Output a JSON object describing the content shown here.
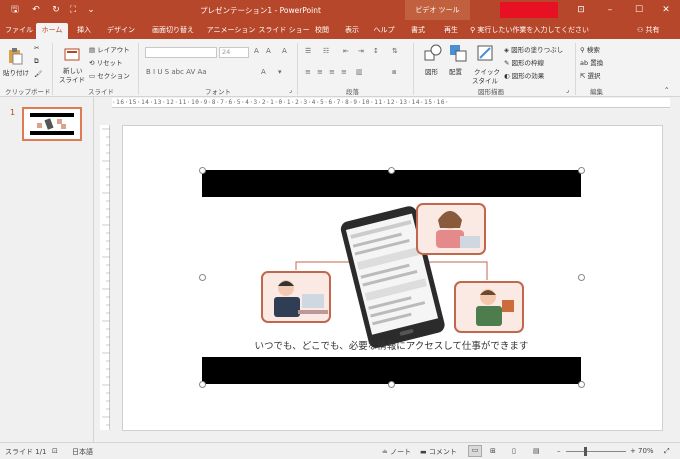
{
  "titlebar": {
    "title": "プレゼンテーション1 - PowerPoint",
    "context_tab": "ビデオ ツール",
    "accent": "#b7472a"
  },
  "tabs": [
    {
      "label": "ファイル"
    },
    {
      "label": "ホーム"
    },
    {
      "label": "挿入"
    },
    {
      "label": "デザイン"
    },
    {
      "label": "画面切り替え"
    },
    {
      "label": "アニメーション"
    },
    {
      "label": "スライド ショー"
    },
    {
      "label": "校閲"
    },
    {
      "label": "表示"
    },
    {
      "label": "ヘルプ"
    },
    {
      "label": "書式"
    },
    {
      "label": "再生"
    }
  ],
  "tell_me": "実行したい作業を入力してください",
  "share": "共有",
  "ribbon": {
    "clipboard": {
      "paste": "貼り付け",
      "group": "クリップボード"
    },
    "slides": {
      "new_slide": "新しい",
      "new_slide2": "スライド",
      "layout": "レイアウト",
      "reset": "リセット",
      "section": "セクション",
      "group": "スライド"
    },
    "font": {
      "size": "24",
      "group": "フォント",
      "format_buttons": "B I U S abc AV Aa"
    },
    "paragraph": {
      "group": "段落"
    },
    "drawing": {
      "shapes": "図形",
      "arrange": "配置",
      "quick_styles": "クイック",
      "quick_styles2": "スタイル",
      "fill": "図形の塗りつぶし",
      "outline": "図形の枠線",
      "effects": "図形の効果",
      "group": "図形描画"
    },
    "editing": {
      "find": "検索",
      "replace": "置換",
      "select": "選択",
      "group": "編集"
    }
  },
  "thumbnail": {
    "number": "1"
  },
  "ruler": {
    "horizontal": "·16·15·14·13·12·11·10·9·8·7·6·5·4·3·2·1·0·1·2·3·4·5·6·7·8·9·10·11·12·13·14·15·16·"
  },
  "slide": {
    "caption": "いつでも、どこでも、必要な情報にアクセスして仕事ができます"
  },
  "statusbar": {
    "slide_info": "スライド 1/1",
    "language": "日本語",
    "notes": "ノート",
    "comments": "コメント",
    "zoom": "70%"
  }
}
